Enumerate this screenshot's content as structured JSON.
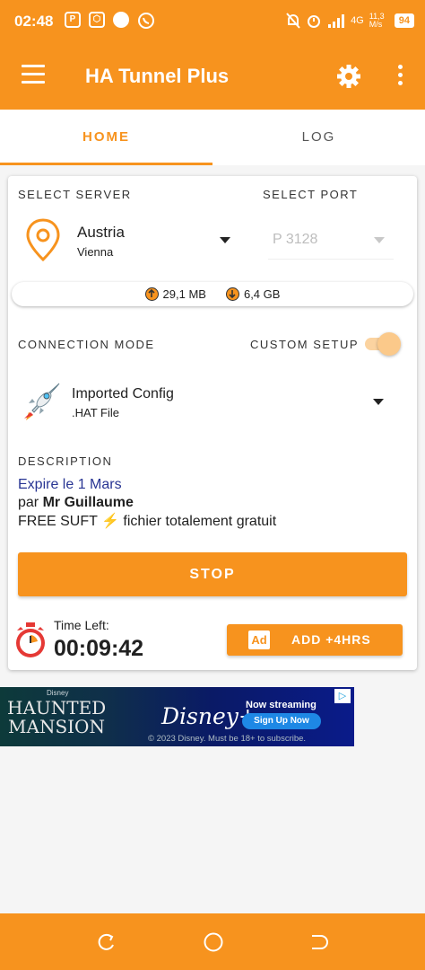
{
  "status_bar": {
    "time": "02:48",
    "network_speed": "11,3 M/s",
    "network_type": "4G",
    "battery": "94"
  },
  "app_bar": {
    "title": "HA Tunnel Plus",
    "menu_icon": "hamburger-menu-icon",
    "settings_icon": "gear-icon",
    "overflow_icon": "more-vert-icon"
  },
  "tabs": [
    {
      "label": "HOME",
      "active": true
    },
    {
      "label": "LOG",
      "active": false
    }
  ],
  "server": {
    "section_label": "SELECT SERVER",
    "country": "Austria",
    "city": "Vienna"
  },
  "port": {
    "section_label": "SELECT PORT",
    "value": "P 3128"
  },
  "traffic": {
    "upload": "29,1 MB",
    "download": "6,4 GB"
  },
  "connection": {
    "mode_label": "CONNECTION MODE",
    "custom_setup_label": "CUSTOM SETUP",
    "custom_setup_on": true,
    "config_name": "Imported Config",
    "config_type": ".HAT File"
  },
  "description": {
    "label": "DESCRIPTION",
    "line1": "Expire le 1 Mars",
    "line2_prefix": "par ",
    "line2_author": "Mr Guillaume",
    "line3_before": "FREE SUFT ",
    "line3_emoji": "⚡",
    "line3_after": " fichier totalement gratuit"
  },
  "actions": {
    "stop_label": "STOP",
    "time_left_label": "Time Left:",
    "time_left_value": "00:09:42",
    "ad_badge": "Ad",
    "add_hours_label": "ADD +4HRS"
  },
  "ad_banner": {
    "brand_small": "Disney",
    "movie_title": "HAUNTED MANSION",
    "service": "Disney+",
    "now_streaming": "Now streaming",
    "signup": "Sign Up Now",
    "legal": "© 2023 Disney. Must be 18+ to subscribe."
  },
  "colors": {
    "accent": "#f7931e",
    "link_blue": "#283593"
  }
}
